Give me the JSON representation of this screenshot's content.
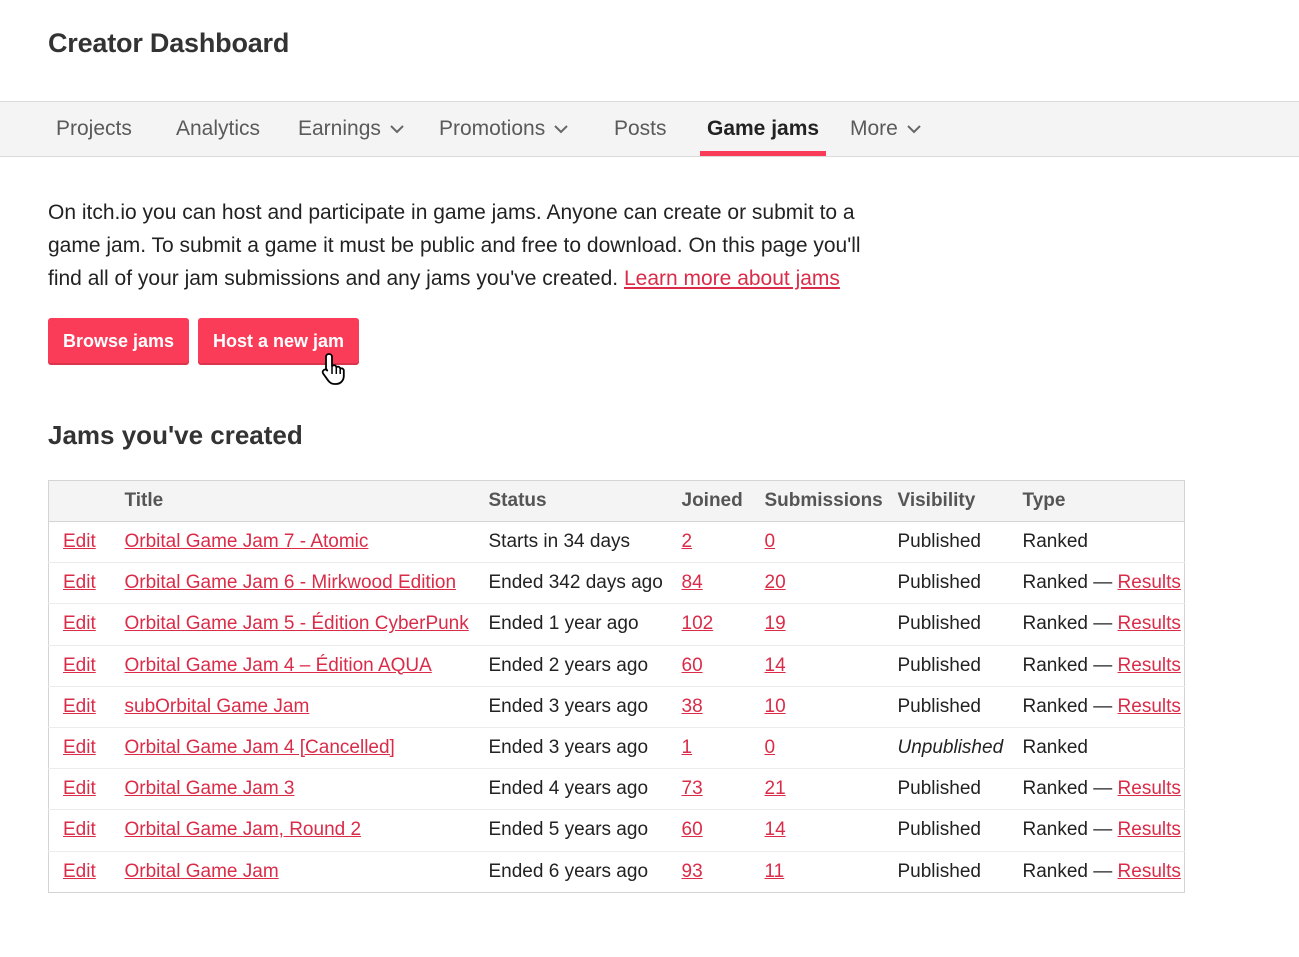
{
  "header": {
    "title": "Creator Dashboard"
  },
  "tabs": [
    {
      "label": "Projects",
      "dropdown": false,
      "active": false
    },
    {
      "label": "Analytics",
      "dropdown": false,
      "active": false
    },
    {
      "label": "Earnings",
      "dropdown": true,
      "active": false
    },
    {
      "label": "Promotions",
      "dropdown": true,
      "active": false
    },
    {
      "label": "Posts",
      "dropdown": false,
      "active": false
    },
    {
      "label": "Game jams",
      "dropdown": false,
      "active": true
    },
    {
      "label": "More",
      "dropdown": true,
      "active": false
    }
  ],
  "intro": {
    "text": "On itch.io you can host and participate in game jams. Anyone can create or submit to a game jam. To submit a game it must be public and free to download. On this page you'll find all of your jam submissions and any jams you've created.",
    "link": "Learn more about jams"
  },
  "buttons": {
    "browse": "Browse jams",
    "host": "Host a new jam"
  },
  "jams_section": {
    "title": "Jams you've created",
    "columns": [
      "",
      "Title",
      "Status",
      "Joined",
      "Submissions",
      "Visibility",
      "Type"
    ],
    "rows": [
      {
        "edit": "Edit",
        "title": "Orbital Game Jam 7 - Atomic",
        "status": "Starts in 34 days",
        "joined": "2",
        "submissions": "0",
        "visibility": "Published",
        "type": "Ranked",
        "results": ""
      },
      {
        "edit": "Edit",
        "title": "Orbital Game Jam 6 - Mirkwood Edition",
        "status": "Ended 342 days ago",
        "joined": "84",
        "submissions": "20",
        "visibility": "Published",
        "type": "Ranked — ",
        "results": "Results"
      },
      {
        "edit": "Edit",
        "title": "Orbital Game Jam 5 - Édition CyberPunk",
        "status": "Ended 1 year ago",
        "joined": "102",
        "submissions": "19",
        "visibility": "Published",
        "type": "Ranked — ",
        "results": "Results"
      },
      {
        "edit": "Edit",
        "title": "Orbital Game Jam 4 – Édition AQUA",
        "status": "Ended 2 years ago",
        "joined": "60",
        "submissions": "14",
        "visibility": "Published",
        "type": "Ranked — ",
        "results": "Results"
      },
      {
        "edit": "Edit",
        "title": "subOrbital Game Jam",
        "status": "Ended 3 years ago",
        "joined": "38",
        "submissions": "10",
        "visibility": "Published",
        "type": "Ranked — ",
        "results": "Results"
      },
      {
        "edit": "Edit",
        "title": "Orbital Game Jam 4 [Cancelled]",
        "status": "Ended 3 years ago",
        "joined": "1",
        "submissions": "0",
        "visibility": "Unpublished",
        "type": "Ranked",
        "results": ""
      },
      {
        "edit": "Edit",
        "title": "Orbital Game Jam 3",
        "status": "Ended 4 years ago",
        "joined": "73",
        "submissions": "21",
        "visibility": "Published",
        "type": "Ranked — ",
        "results": "Results"
      },
      {
        "edit": "Edit",
        "title": "Orbital Game Jam, Round 2",
        "status": "Ended 5 years ago",
        "joined": "60",
        "submissions": "14",
        "visibility": "Published",
        "type": "Ranked — ",
        "results": "Results"
      },
      {
        "edit": "Edit",
        "title": "Orbital Game Jam",
        "status": "Ended 6 years ago",
        "joined": "93",
        "submissions": "11",
        "visibility": "Published",
        "type": "Ranked — ",
        "results": "Results"
      }
    ]
  },
  "colors": {
    "accent": "#fa3c58",
    "link": "#da2c49",
    "tabbar_bg": "#f4f4f4"
  },
  "icons": {
    "dropdown": "chevron-down-icon",
    "cursor": "hand-pointer-cursor-icon"
  }
}
